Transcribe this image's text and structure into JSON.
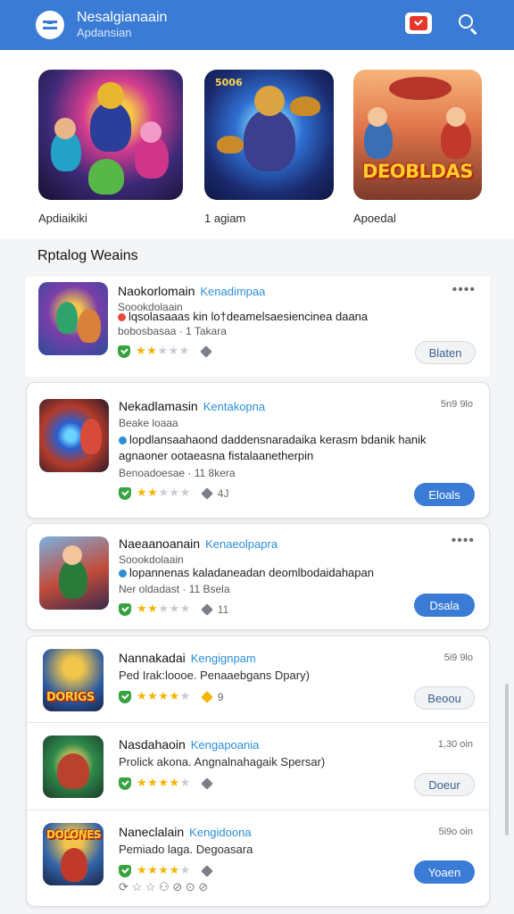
{
  "appbar": {
    "title": "Nesalgianaain",
    "subtitle": "Apdansian"
  },
  "featured": [
    {
      "label": "Apdiaikiki",
      "tag": ""
    },
    {
      "label": "1 agiam",
      "tag": "5006"
    },
    {
      "label": "Apoedal",
      "logo": "DEOBLDAS"
    }
  ],
  "section_title": "Rptalog Weains",
  "rows": [
    {
      "name": "Naokorlomain",
      "dev": "Kenadimpaa",
      "line2": "Soookdolaain",
      "desc": "lqsolasaaas kin lo†deamelsaesiencinea daana",
      "meta": "bobosbasaa · 1 Takara",
      "stars": 2,
      "count": "",
      "menu": "••••",
      "button": "Blaten",
      "dot_color": "#e84b3c"
    },
    {
      "name": "Nekadlamasin",
      "dev": "Kentakopna",
      "line2": "Beake loaaa",
      "desc": "lopdlansaahaond daddensnaradaika kerasm bdanik hanik agnaoner ootaeasna fistalaanetherpin",
      "meta": "Benoadoesae · 11 8kera",
      "stars": 2,
      "count": "4J",
      "size": "5n9 9lo",
      "button": "Eloals",
      "dot_color": "#2b8fd6"
    },
    {
      "name": "Naeaanoanain",
      "dev": "Kenaeolpapra",
      "line2": "Soookdolaain",
      "desc": "lopannenas kaladaneadan deomlbodaidahapan",
      "meta": "Ner oldadast · 11 Bsela",
      "stars": 2,
      "count": "11",
      "menu": "••••",
      "button": "Dsala",
      "dot_color": "#2b8fd6"
    },
    {
      "name": "Nannakadai",
      "dev": "Kengignpam",
      "line2": "Ped Irak:loooe. Penaaebgans Dpary)",
      "meta": "",
      "stars": 4,
      "count": "9",
      "size": "5i9 9lo",
      "button": "Beoou",
      "logo": "DORIGS"
    },
    {
      "name": "Nasdahaoin",
      "dev": "Kengapoania",
      "line2": "Prolick akona. Angnalnahagaik Spersar)",
      "meta": "",
      "stars": 4,
      "count": "",
      "size": "1,30 oin",
      "button": "Doeur"
    },
    {
      "name": "Naneclalain",
      "dev": "Kengidoona",
      "line2": "Pemiado laga. Degoasara",
      "meta": "",
      "stars": 4,
      "count": "",
      "size": "5i9o oin",
      "button": "Yoaen",
      "logo": "DOLONES",
      "footer": "⟳ ☆ ☆ ⚇ ⊘ ⊙ ⊘"
    }
  ],
  "colors": {
    "appbar": "#3a7bd5",
    "accent": "#2b8fd6",
    "star": "#f5b400",
    "shield": "#37a340"
  }
}
